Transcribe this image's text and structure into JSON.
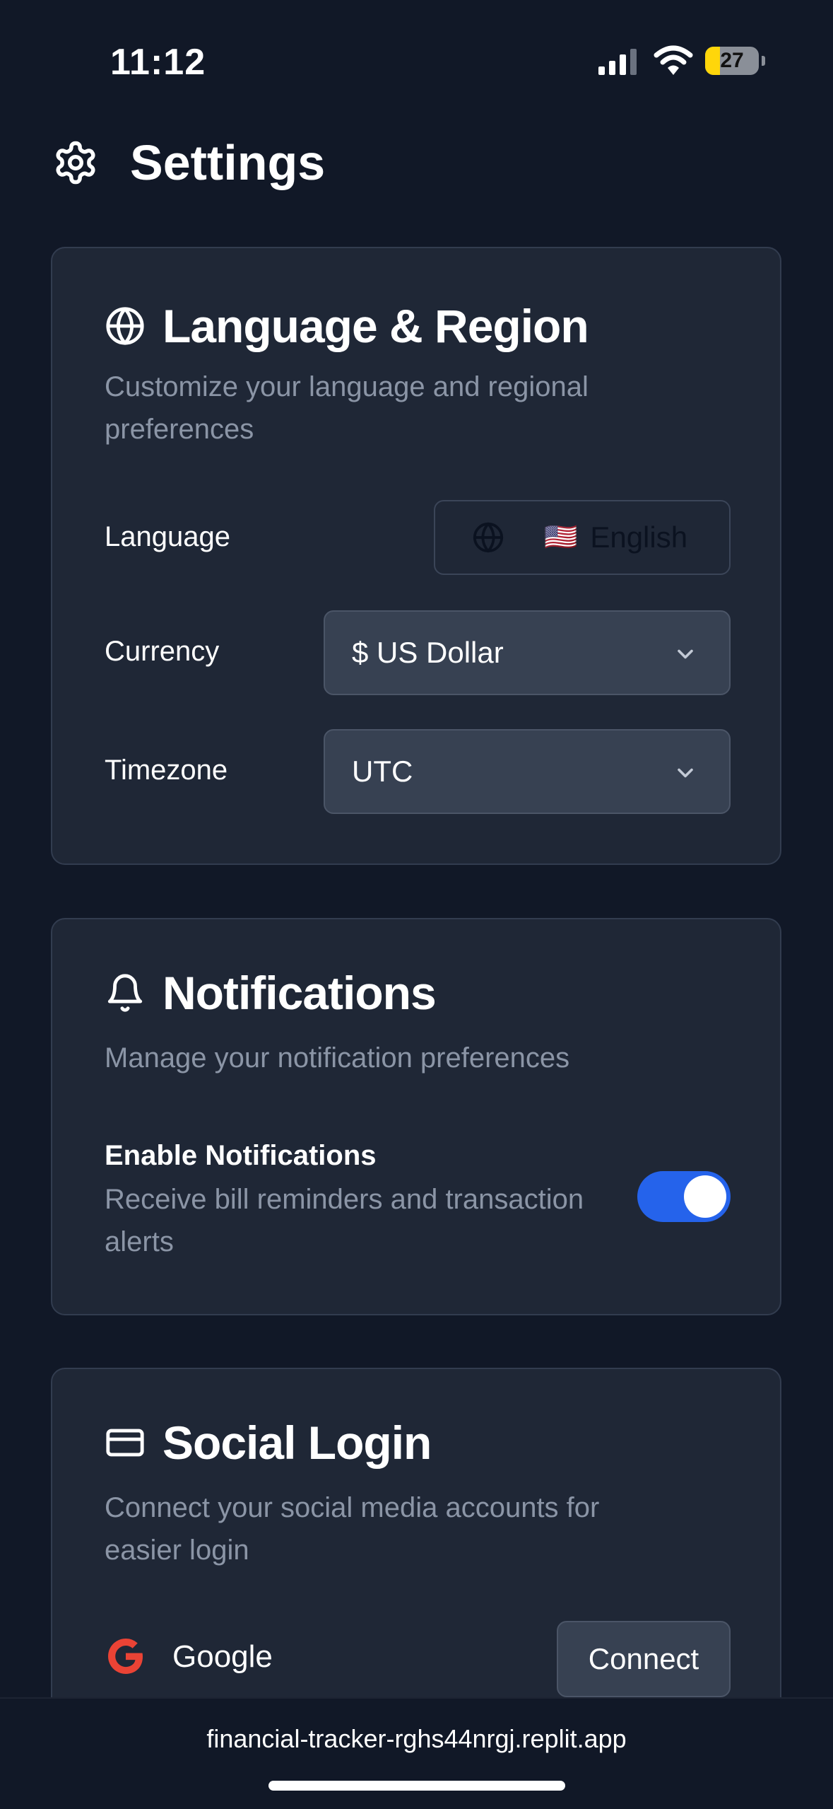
{
  "status_bar": {
    "time": "11:12",
    "battery_level": "27",
    "battery_fraction": 0.27
  },
  "header": {
    "title": "Settings",
    "icon": "gear-icon"
  },
  "language_region": {
    "title": "Language & Region",
    "icon": "globe-icon",
    "description": "Customize your language and regional preferences",
    "language_label": "Language",
    "language_flag": "🇺🇸",
    "language_value": "English",
    "currency_label": "Currency",
    "currency_value": "$ US Dollar",
    "timezone_label": "Timezone",
    "timezone_value": "UTC"
  },
  "notifications": {
    "title": "Notifications",
    "icon": "bell-icon",
    "description": "Manage your notification preferences",
    "enable_label": "Enable Notifications",
    "enable_description": "Receive bill reminders and transaction alerts",
    "enabled": true
  },
  "social_login": {
    "title": "Social Login",
    "icon": "credit-card-icon",
    "description": "Connect your social media accounts for easier login",
    "providers": [
      {
        "name": "Google",
        "icon": "google-icon",
        "action": "Connect"
      }
    ]
  },
  "browser": {
    "url": "financial-tracker-rghs44nrgj.replit.app"
  },
  "colors": {
    "background": "#111827",
    "card": "#1f2736",
    "accent": "#2563eb",
    "google_red": "#ea4335"
  }
}
